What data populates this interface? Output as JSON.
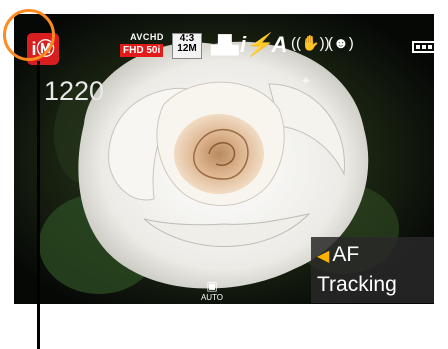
{
  "screen": {
    "mode_icon": "intelligent-auto-icon",
    "mode_glyph": "iⓂ",
    "recording_format": "AVCHD",
    "movie_quality": "FHD 50i",
    "aspect_ratio": "4:3",
    "picture_size": "12M",
    "quality_icon": "fine-quality-icon",
    "ia_label": "i⚡A",
    "stabilizer_icon": "stabilizer-icon",
    "face_icon": "face-detect-icon",
    "battery_icon": "battery-icon",
    "remaining_shots": "1220",
    "af_tracking_label": "AF Tracking",
    "auto_label": "AUTO"
  },
  "colors": {
    "highlight_ring": "#ff8a1f",
    "mode_badge": "#d81e1e",
    "tracking_arrow": "#ffb300"
  }
}
